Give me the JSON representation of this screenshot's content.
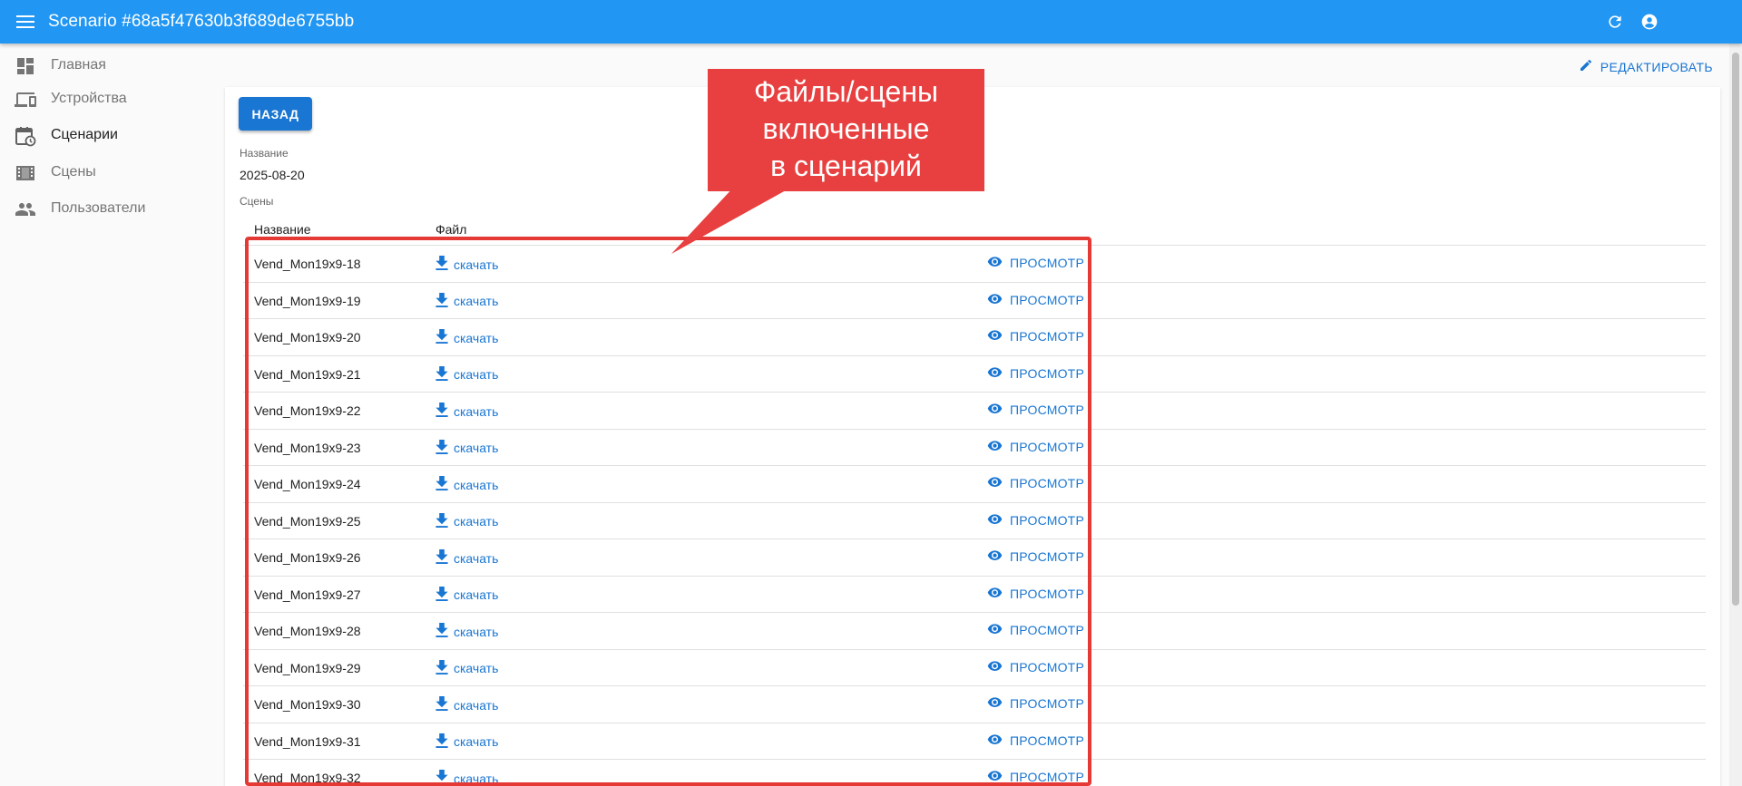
{
  "appbar": {
    "title": "Scenario #68a5f47630b3f689de6755bb",
    "icons": [
      "menu-icon",
      "refresh-icon",
      "account-circle-icon"
    ]
  },
  "sidebar": {
    "items": [
      {
        "label": "Главная",
        "icon": "dashboard-icon"
      },
      {
        "label": "Устройства",
        "icon": "devices-icon"
      },
      {
        "label": "Сценарии",
        "icon": "calendar-clock-icon"
      },
      {
        "label": "Сцены",
        "icon": "movie-icon"
      },
      {
        "label": "Пользователи",
        "icon": "people-icon"
      }
    ]
  },
  "edit": {
    "label": "РЕДАКТИРОВАТЬ"
  },
  "main": {
    "back_label": "НАЗАД",
    "name_label": "Название",
    "name_value": "2025-08-20",
    "scenes_label": "Сцены",
    "table": {
      "headers": [
        "Название",
        "Файл"
      ],
      "download_label": "скачать",
      "view_label": "ПРОСМОТР",
      "rows": [
        "Vend_Mon19x9-18",
        "Vend_Mon19x9-19",
        "Vend_Mon19x9-20",
        "Vend_Mon19x9-21",
        "Vend_Mon19x9-22",
        "Vend_Mon19x9-23",
        "Vend_Mon19x9-24",
        "Vend_Mon19x9-25",
        "Vend_Mon19x9-26",
        "Vend_Mon19x9-27",
        "Vend_Mon19x9-28",
        "Vend_Mon19x9-29",
        "Vend_Mon19x9-30",
        "Vend_Mon19x9-31",
        "Vend_Mon19x9-32"
      ]
    }
  },
  "callout": {
    "lines": [
      "Файлы/сцены",
      "включенные",
      "в сценарий"
    ]
  },
  "colors": {
    "appbar": "#2196f3",
    "primary": "#1976d2",
    "annotation": "#e53935"
  }
}
